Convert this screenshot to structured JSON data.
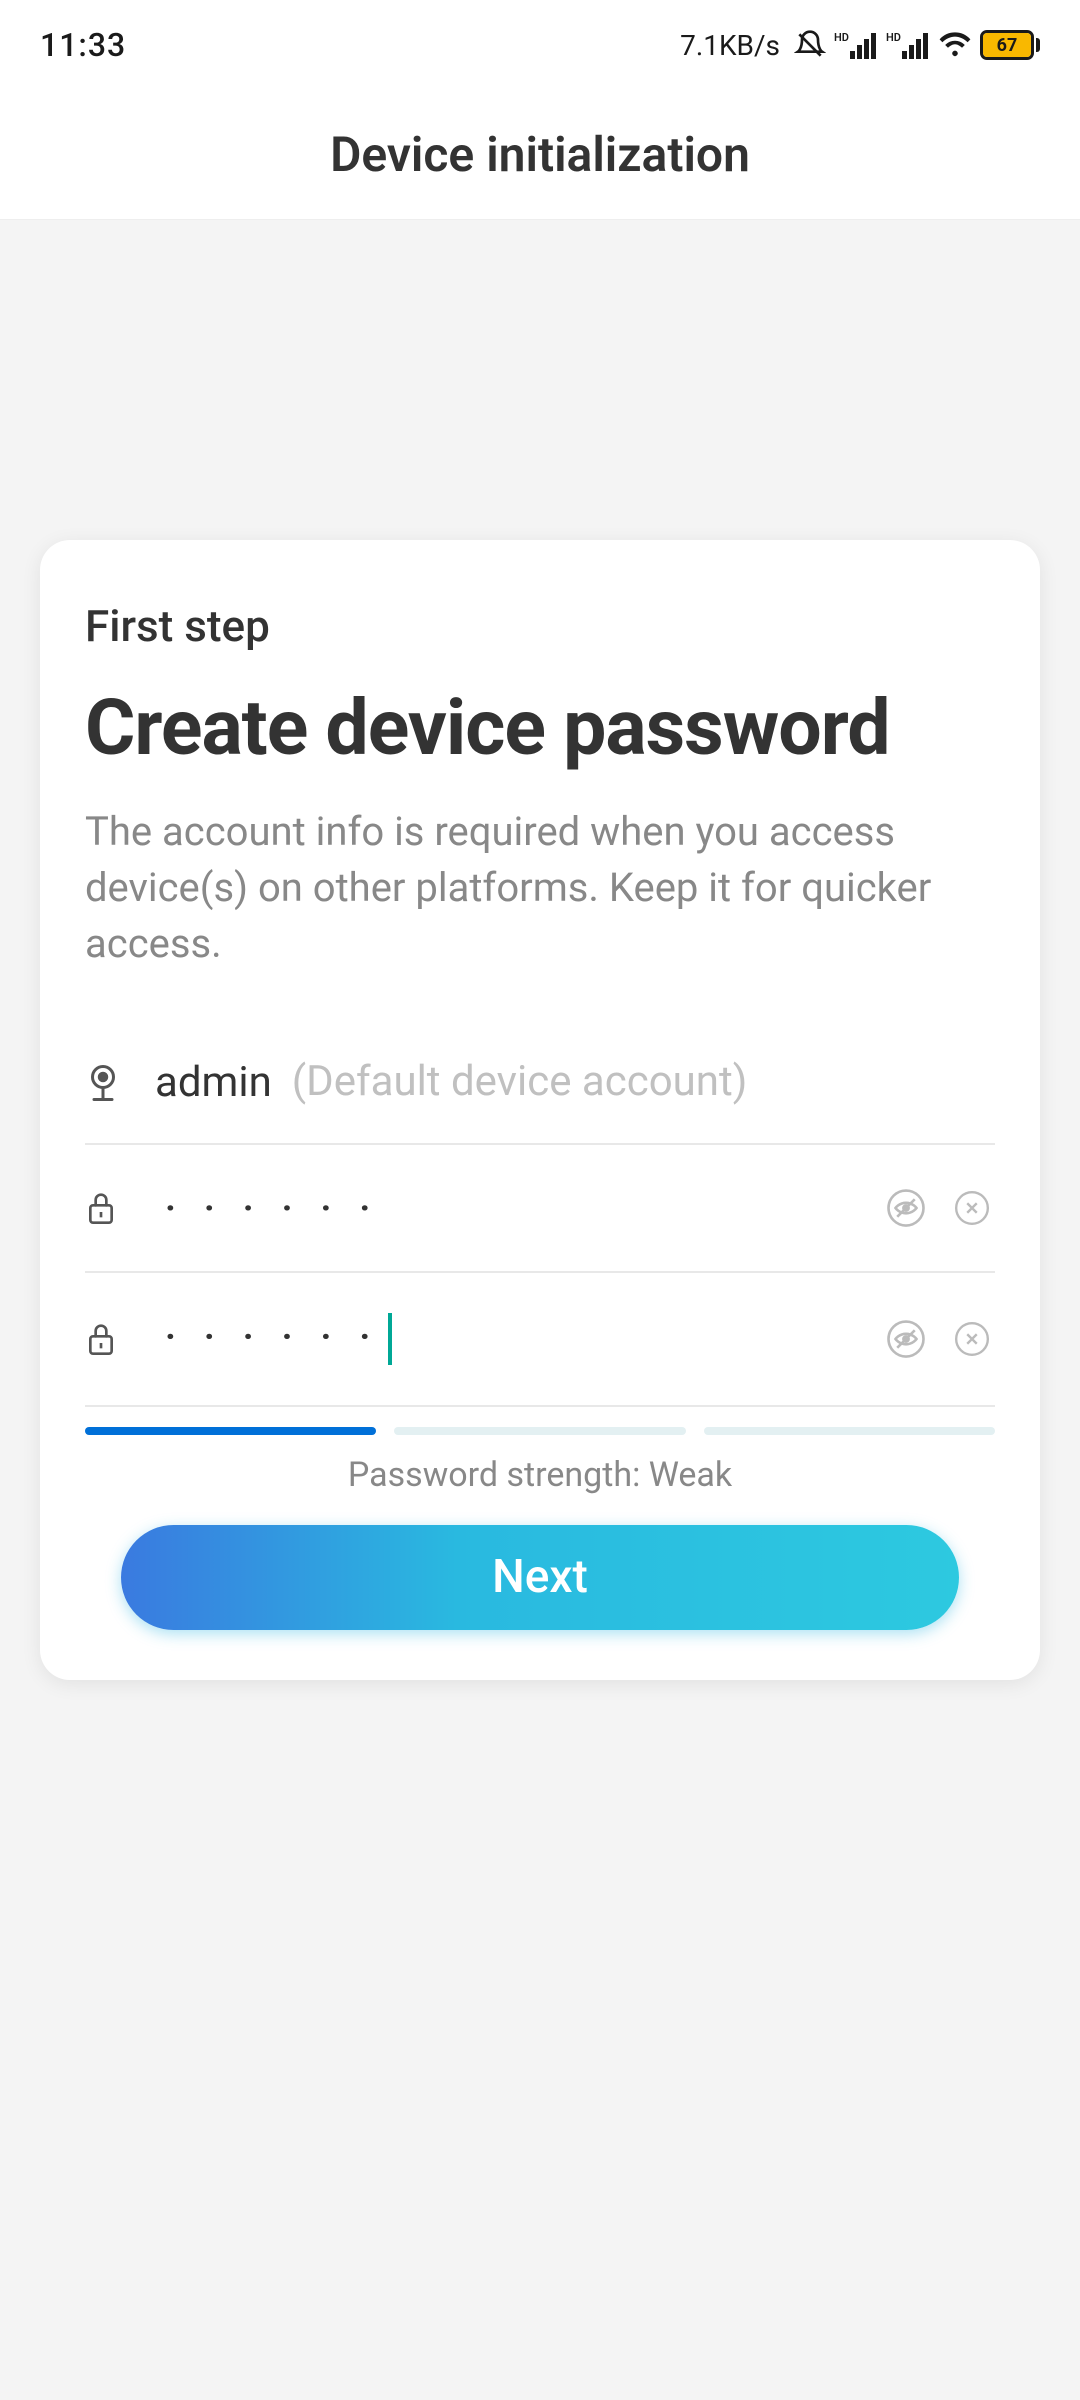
{
  "statusbar": {
    "time": "11:33",
    "speed": "7.1KB/s",
    "battery": "67"
  },
  "header": {
    "title": "Device initialization"
  },
  "card": {
    "step_label": "First step",
    "title": "Create device password",
    "description": "The account info is required when you access device(s) on other platforms. Keep it for quicker access.",
    "username": {
      "value": "admin",
      "hint": "(Default device account)"
    },
    "password": {
      "value": "······",
      "masked": true
    },
    "confirm_password": {
      "value": "······",
      "masked": true,
      "focused": true
    },
    "strength": {
      "label": "Password strength: Weak",
      "level": 1,
      "bars": 3
    },
    "next_button": "Next"
  }
}
